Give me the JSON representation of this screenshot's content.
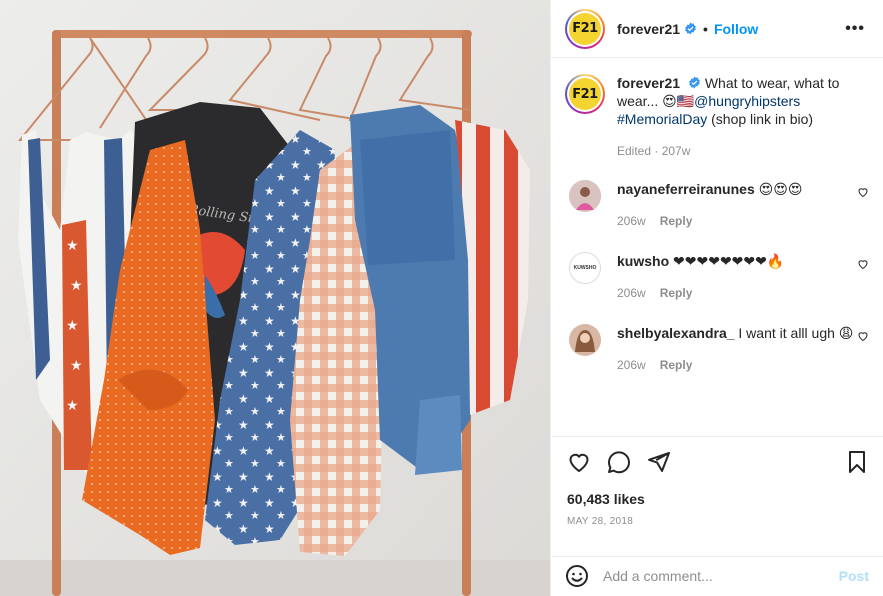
{
  "post": {
    "image_alt": "Clothing rack with patriotic outfits",
    "rack_print": "The Rolling Stones"
  },
  "header": {
    "logo_text": "F21",
    "username": "forever21",
    "separator": "•",
    "follow_label": "Follow",
    "more_label": "•••"
  },
  "caption": {
    "username": "forever21",
    "text_before": "What to wear, what to wear...",
    "emojis": "😍🇺🇸",
    "mention": "@hungryhipsters",
    "hashtag": "#MemorialDay",
    "text_after": "(shop link in bio)",
    "meta": "Edited · 207w"
  },
  "comments": [
    {
      "username": "nayaneferreiranunes",
      "text": "😍😍😍",
      "age": "206w",
      "reply": "Reply",
      "avatar_color": "#c9a6a2"
    },
    {
      "username": "kuwsho",
      "text": "❤❤❤❤❤❤❤❤🔥",
      "age": "206w",
      "reply": "Reply",
      "avatar_color": "#ffffff",
      "avatar_text": "KUWSHO"
    },
    {
      "username": "shelbyalexandra_",
      "text": "I want it alll ugh 😩",
      "age": "206w",
      "reply": "Reply",
      "avatar_color": "#b4836b"
    }
  ],
  "stats": {
    "likes": "60,483 likes",
    "date": "MAY 28, 2018"
  },
  "composer": {
    "placeholder": "Add a comment...",
    "post_label": "Post"
  },
  "colors": {
    "accent": "#0095f6",
    "post_disabled": "#b2dffc",
    "muted": "#8e8e8e"
  }
}
